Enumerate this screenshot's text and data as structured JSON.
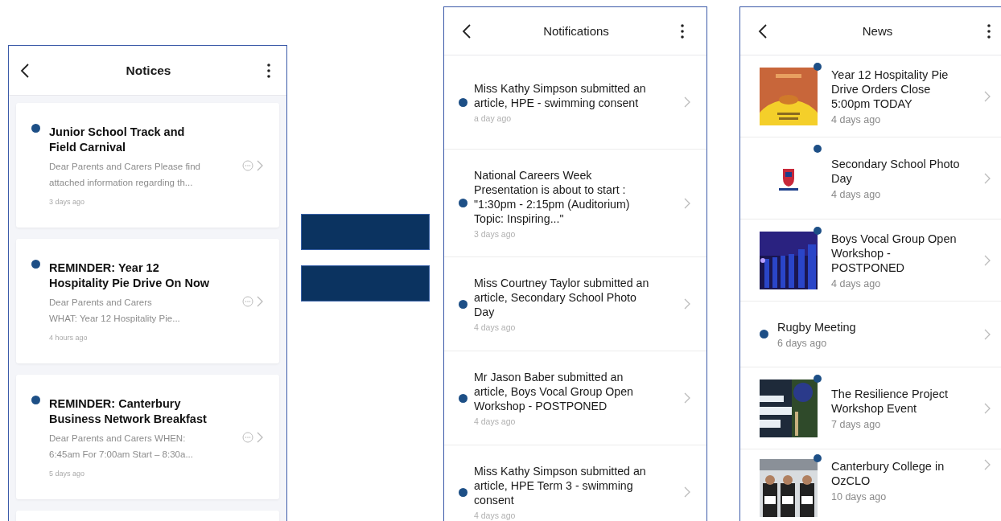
{
  "notices": {
    "title": "Notices",
    "items": [
      {
        "title": "Junior School Track and Field Carnival",
        "preview": "Dear Parents and Carers Please find\nattached information regarding th...",
        "time": "3 days ago",
        "unread": true
      },
      {
        "title": "REMINDER: Year 12 Hospitality Pie Drive On Now",
        "preview": "Dear Parents and Carers\nWHAT: Year 12 Hospitality Pie...",
        "time": "4 hours ago",
        "unread": true
      },
      {
        "title": "REMINDER: Canterbury Business Network Breakfast",
        "preview": "Dear Parents and Carers WHEN:\n6:45am For 7:00am Start – 8:30a...",
        "time": "5 days ago",
        "unread": true
      }
    ]
  },
  "notifications": {
    "title": "Notifications",
    "items": [
      {
        "text": "Miss Kathy Simpson submitted an article, HPE - swimming consent",
        "time": "a day ago",
        "unread": true
      },
      {
        "text": "National Careers Week Presentation is about to start : \"1:30pm - 2:15pm (Auditorium) Topic: Inspiring...\"",
        "time": "3 days ago",
        "unread": true
      },
      {
        "text": "Miss Courtney Taylor submitted an article, Secondary School Photo Day",
        "time": "4 days ago",
        "unread": true
      },
      {
        "text": "Mr Jason Baber submitted an article, Boys Vocal Group Open Workshop - POSTPONED",
        "time": "4 days ago",
        "unread": true
      },
      {
        "text": "Miss Kathy Simpson submitted an article, HPE Term 3 - swimming consent",
        "time": "4 days ago",
        "unread": true
      }
    ]
  },
  "news": {
    "title": "News",
    "items": [
      {
        "title": "Year 12 Hospitality Pie Drive Orders Close 5:00pm TODAY",
        "time": "4 days ago",
        "unread": true,
        "kind": "picture"
      },
      {
        "title": "Secondary School Photo Day",
        "time": "4 days ago",
        "unread": true,
        "kind": "picture"
      },
      {
        "title": "Boys Vocal Group Open Workshop - POSTPONED",
        "time": "4 days ago",
        "unread": true,
        "kind": "picture"
      },
      {
        "title": "Rugby Meeting",
        "time": "6 days ago",
        "unread": true,
        "kind": "text"
      },
      {
        "title": "The Resilience Project Workshop Event",
        "time": "7 days ago",
        "unread": true,
        "kind": "picture"
      },
      {
        "title": "Canterbury College in OzCLO",
        "time": "10 days ago",
        "unread": true,
        "kind": "picture"
      }
    ]
  }
}
